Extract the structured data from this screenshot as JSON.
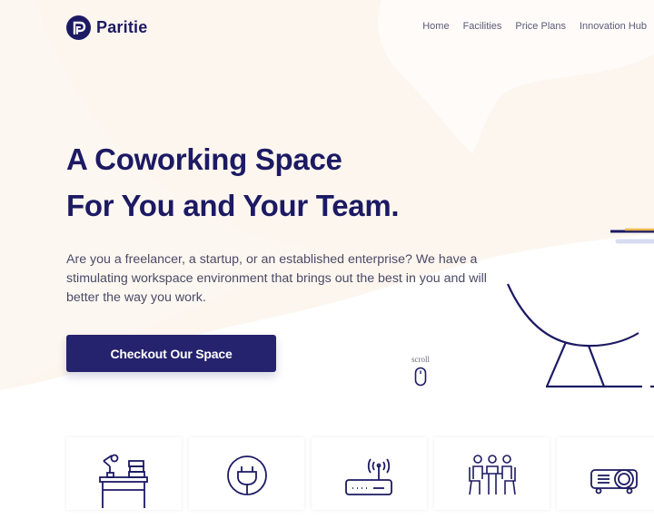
{
  "brand": {
    "name": "Paritie",
    "logo_icon": "p-logo-icon"
  },
  "nav": {
    "items": [
      {
        "label": "Home"
      },
      {
        "label": "Facilities"
      },
      {
        "label": "Price Plans"
      },
      {
        "label": "Innovation Hub"
      }
    ]
  },
  "hero": {
    "title_line1": "A Coworking Space",
    "title_line2": "For You and Your Team.",
    "description": "Are you a freelancer, a startup, or an established enterprise? We have a stimulating workspace environment that brings out the best in you and will better the way you work.",
    "cta_label": "Checkout Our Space",
    "scroll_label": "scroll"
  },
  "facilities": {
    "items": [
      {
        "icon": "desk-lamp-icon"
      },
      {
        "icon": "power-plug-icon"
      },
      {
        "icon": "wifi-router-icon"
      },
      {
        "icon": "meeting-room-icon"
      },
      {
        "icon": "projector-icon"
      }
    ]
  },
  "colors": {
    "primary": "#1c1a63",
    "button": "#25226e",
    "blob": "#fdf6ef",
    "accent_gold": "#e8b84a",
    "accent_lavender": "#d9dcf0",
    "text_muted": "#4a4a66"
  }
}
